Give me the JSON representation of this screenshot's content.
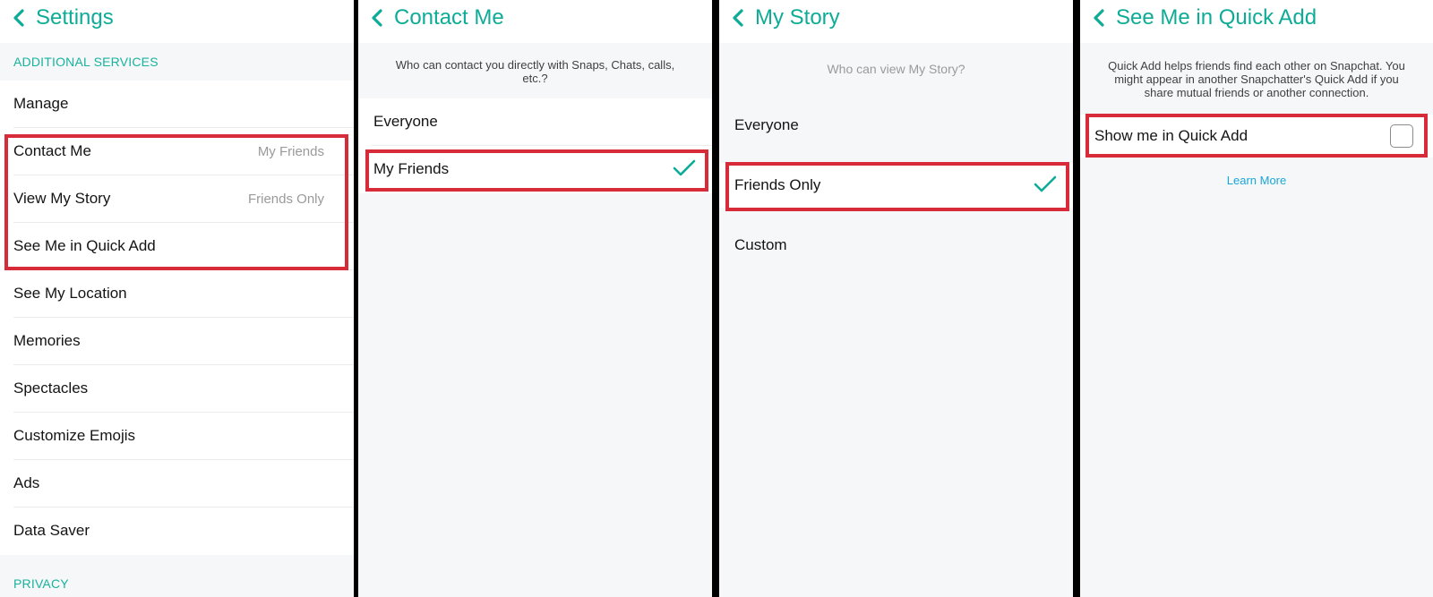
{
  "accent_color": "#0eac97",
  "highlight_color": "#d72b3a",
  "settings": {
    "title": "Settings",
    "section_additional": "ADDITIONAL SERVICES",
    "items": [
      {
        "label": "Manage",
        "value": ""
      },
      {
        "label": "Contact Me",
        "value": "My Friends"
      },
      {
        "label": "View My Story",
        "value": "Friends Only"
      },
      {
        "label": "See Me in Quick Add",
        "value": ""
      },
      {
        "label": "See My Location",
        "value": ""
      },
      {
        "label": "Memories",
        "value": ""
      },
      {
        "label": "Spectacles",
        "value": ""
      },
      {
        "label": "Customize Emojis",
        "value": ""
      },
      {
        "label": "Ads",
        "value": ""
      },
      {
        "label": "Data Saver",
        "value": ""
      }
    ],
    "section_privacy": "PRIVACY"
  },
  "contact_me": {
    "title": "Contact Me",
    "hint": "Who can contact you directly with Snaps, Chats, calls, etc.?",
    "options": [
      {
        "label": "Everyone",
        "selected": false
      },
      {
        "label": "My Friends",
        "selected": true
      }
    ]
  },
  "my_story": {
    "title": "My Story",
    "hint": "Who can view My Story?",
    "options": [
      {
        "label": "Everyone",
        "selected": false
      },
      {
        "label": "Friends Only",
        "selected": true
      },
      {
        "label": "Custom",
        "selected": false
      }
    ]
  },
  "quick_add": {
    "title": "See Me in Quick Add",
    "hint": "Quick Add helps friends find each other on Snapchat. You might appear in another Snapchatter's Quick Add if you share mutual friends or another connection.",
    "toggle_label": "Show me in Quick Add",
    "toggle_checked": false,
    "learn_more": "Learn More"
  },
  "icons": {
    "back": "chevron-left-icon",
    "check": "checkmark-icon",
    "checkbox": "checkbox-unchecked-icon"
  }
}
